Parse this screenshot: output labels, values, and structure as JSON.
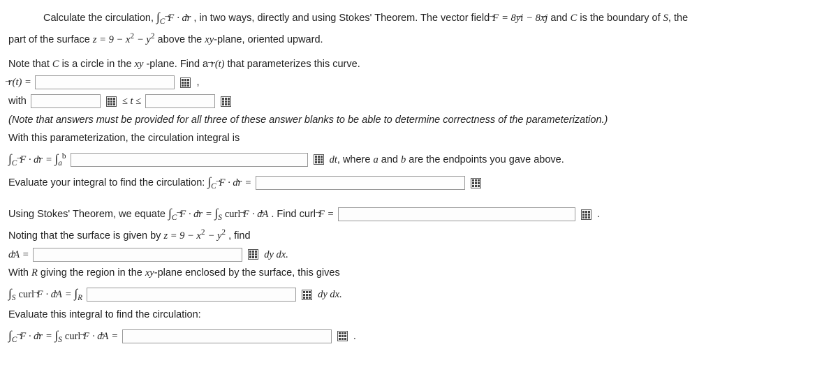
{
  "problem": {
    "intro_prefix": "Calculate the circulation, ",
    "intro_integral_sub": "C",
    "intro_integral_expr_F": "F",
    "intro_integral_expr_dot_dr": " · d",
    "intro_integral_expr_r": "r",
    "intro_mid": ", in two ways, directly and using Stokes' Theorem. The vector field ",
    "intro_F": "F",
    "intro_eq": " = 8y",
    "intro_i": "i",
    "intro_minus": " − 8x",
    "intro_j": "j",
    "intro_after": " and ",
    "intro_C": "C",
    "intro_boundary": " is the boundary of ",
    "intro_S": "S",
    "intro_the": ", the",
    "surface_line_a": "part of the surface ",
    "surface_eq": "z = 9 − x",
    "surface_sq1": "2",
    "surface_mid": " − y",
    "surface_sq2": "2",
    "surface_after": " above the ",
    "surface_xy": "xy",
    "surface_plane": "-plane, oriented upward."
  },
  "noteCircle": {
    "a": "Note that ",
    "C": "C",
    "b": " is a circle in the ",
    "xy": "xy",
    "c": "-plane. Find a ",
    "r": "r",
    "t": "(t)",
    "d": " that parameterizes this curve."
  },
  "param": {
    "r": "r",
    "tEq": "(t) = ",
    "comma": ",",
    "with": "with",
    "leq1": " ≤ t ≤ "
  },
  "paramNote": "(Note that answers must be provided for all three of these answer blanks to be able to determine correctness of the parameterization.)",
  "withParam": "With this parameterization, the circulation integral is",
  "circIntegral": {
    "sub1": "C",
    "F": "F",
    "dot_dr": " · d",
    "r": "r",
    "eq": " = ",
    "ab_a": "a",
    "ab_b": "b",
    "after": "dt",
    "where": ", where ",
    "a": "a",
    "and": " and ",
    "b": "b",
    "end": " are the endpoints you gave above."
  },
  "evaluate": {
    "pre": "Evaluate your integral to find the circulation: ",
    "sub": "C",
    "F": "F",
    "dot_dr": " · d",
    "r": "r",
    "eq": " = "
  },
  "stokes": {
    "pre": "Using Stokes' Theorem, we equate ",
    "subC": "C",
    "F": "F",
    "dot_dr": " · d",
    "r": "r",
    "eq": " = ",
    "subS": "S",
    "curl": " curl ",
    "F2": "F",
    "dot_dA": " · d",
    "A": "A",
    "find": ". Find curl ",
    "F3": "F",
    "eq2": " = ",
    "dot": "."
  },
  "noting": {
    "pre": "Noting that the surface is given by ",
    "eq": "z = 9 − x",
    "sq1": "2",
    "mid": " − y",
    "sq2": "2",
    "find": ", find"
  },
  "dA": {
    "d": "d",
    "A": "A",
    "eq": " = ",
    "dydx": "dy dx."
  },
  "withR": {
    "pre": "With ",
    "R": "R",
    "mid": " giving the region in the ",
    "xy": "xy",
    "after": "-plane enclosed by the surface, this gives"
  },
  "curlInt": {
    "subS": "S",
    "curl": " curl ",
    "F": "F",
    "dot_dA": " · d",
    "A": "A",
    "eq": " = ",
    "subR": "R",
    "dydx": "dy dx."
  },
  "finalEval": "Evaluate this integral to find the circulation:",
  "finalLine": {
    "subC": "C",
    "F": "F",
    "dot_dr": " · d",
    "r": "r",
    "eq": " = ",
    "subS": "S",
    "curl": " curl ",
    "F2": "F",
    "dot_dA": " · d",
    "A": "A",
    "eq2": " = ",
    "dot": "."
  }
}
